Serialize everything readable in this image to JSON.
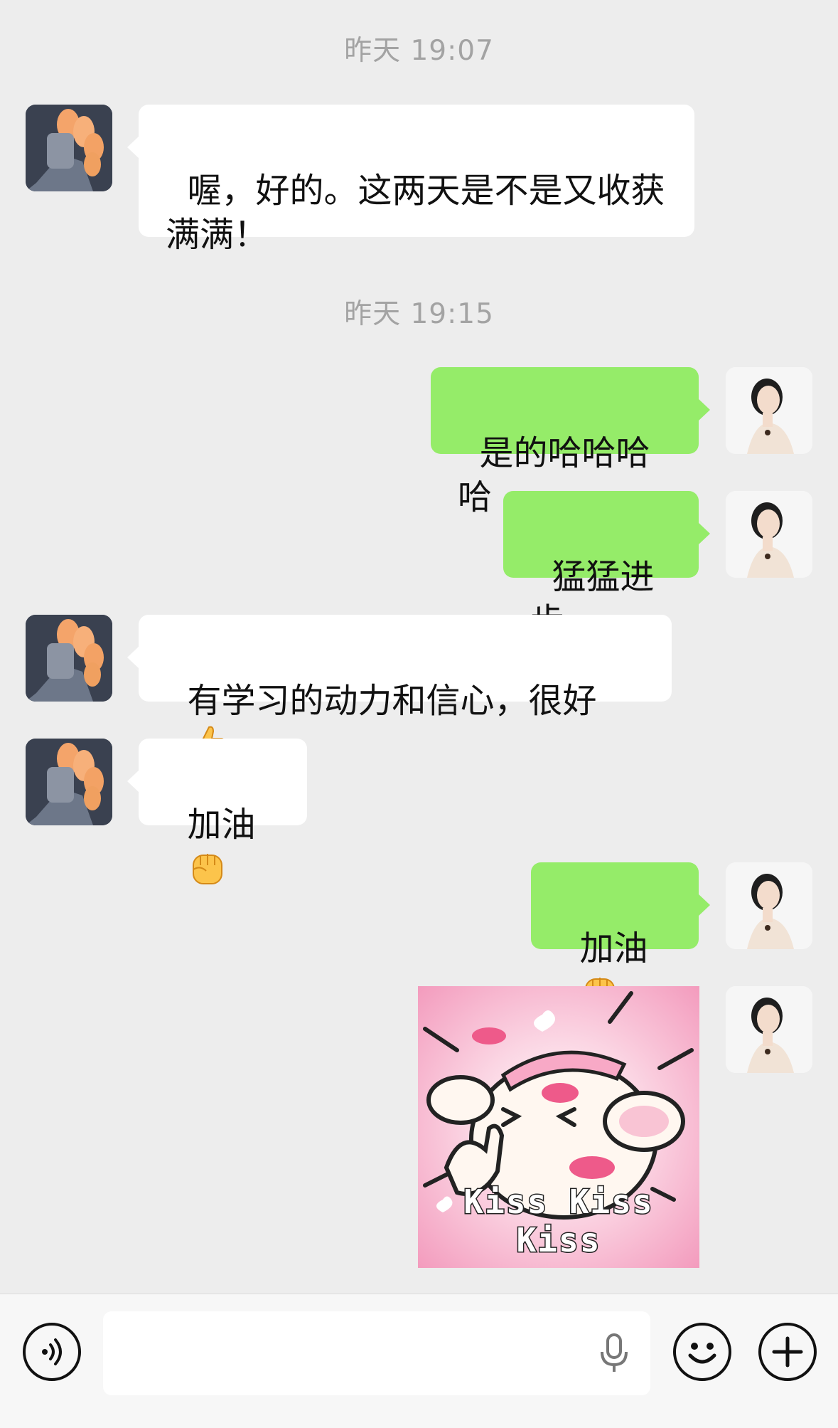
{
  "messages": {
    "ts1": "昨天 19:07",
    "m1": "喔，好的。这两天是不是又收获\n满满！",
    "ts2": "昨天 19:15",
    "m2": "是的哈哈哈哈",
    "m3": "猛猛进步",
    "m4": "有学习的动力和信心，很好",
    "m5": "加油",
    "m6": "加油",
    "sticker_text": "Kiss Kiss Kiss"
  },
  "emojis": {
    "m4": "thumbs-up-icon",
    "m5": "raised-fist-icon",
    "m6": "raised-fist-icon"
  },
  "colors": {
    "background": "#ededed",
    "incoming_bubble": "#ffffff",
    "outgoing_bubble": "#95ec69",
    "timestamp": "#a3a3a3"
  },
  "input": {
    "value": "",
    "placeholder": ""
  }
}
